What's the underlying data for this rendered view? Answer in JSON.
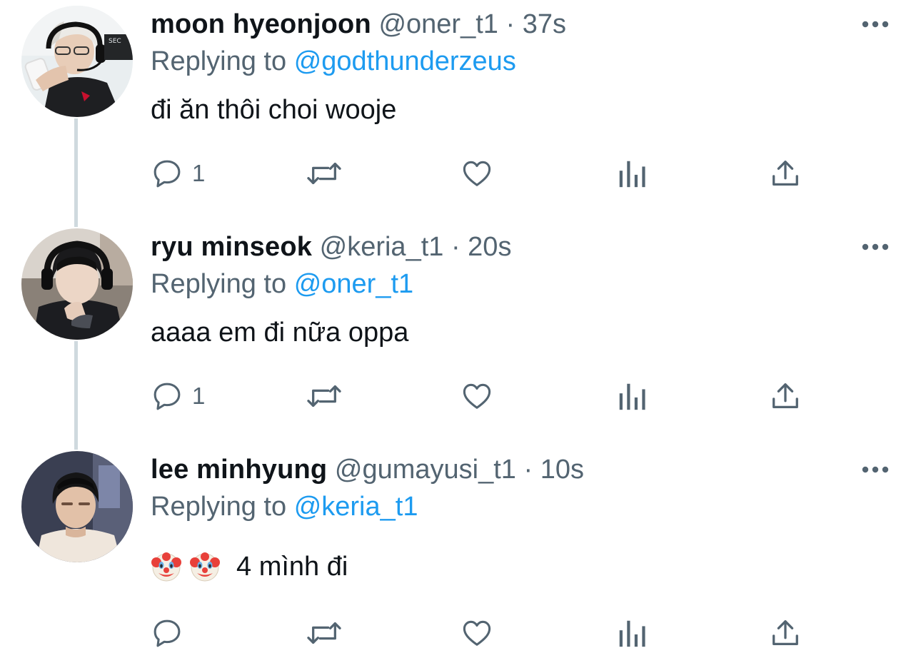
{
  "colors": {
    "text": "#0f1419",
    "secondary": "#536471",
    "link": "#1d9bf0",
    "thread_line": "#cfd9de"
  },
  "tweets": [
    {
      "name": "moon hyeonjoon",
      "handle": "@oner_t1",
      "separator": "·",
      "time": "37s",
      "reply_prefix": "Replying to",
      "reply_to": "@godthunderzeus",
      "text": "đi ăn thôi choi wooje",
      "emojis": [],
      "reply_count": "1",
      "avatar_icon": "avatar-photo"
    },
    {
      "name": "ryu minseok",
      "handle": "@keria_t1",
      "separator": "·",
      "time": "20s",
      "reply_prefix": "Replying to",
      "reply_to": "@oner_t1",
      "text": "aaaa em đi nữa oppa",
      "emojis": [],
      "reply_count": "1",
      "avatar_icon": "avatar-photo"
    },
    {
      "name": "lee minhyung",
      "handle": "@gumayusi_t1",
      "separator": "·",
      "time": "10s",
      "reply_prefix": "Replying to",
      "reply_to": "@keria_t1",
      "text": "4 mình đi",
      "emojis": [
        "clown-face-emoji",
        "clown-face-emoji"
      ],
      "reply_count": "",
      "avatar_icon": "avatar-photo"
    }
  ],
  "icons": {
    "more": "more-horizontal-icon",
    "reply": "reply-bubble-icon",
    "retweet": "retweet-icon",
    "like": "heart-icon",
    "views": "bar-chart-icon",
    "share": "share-upload-icon"
  }
}
